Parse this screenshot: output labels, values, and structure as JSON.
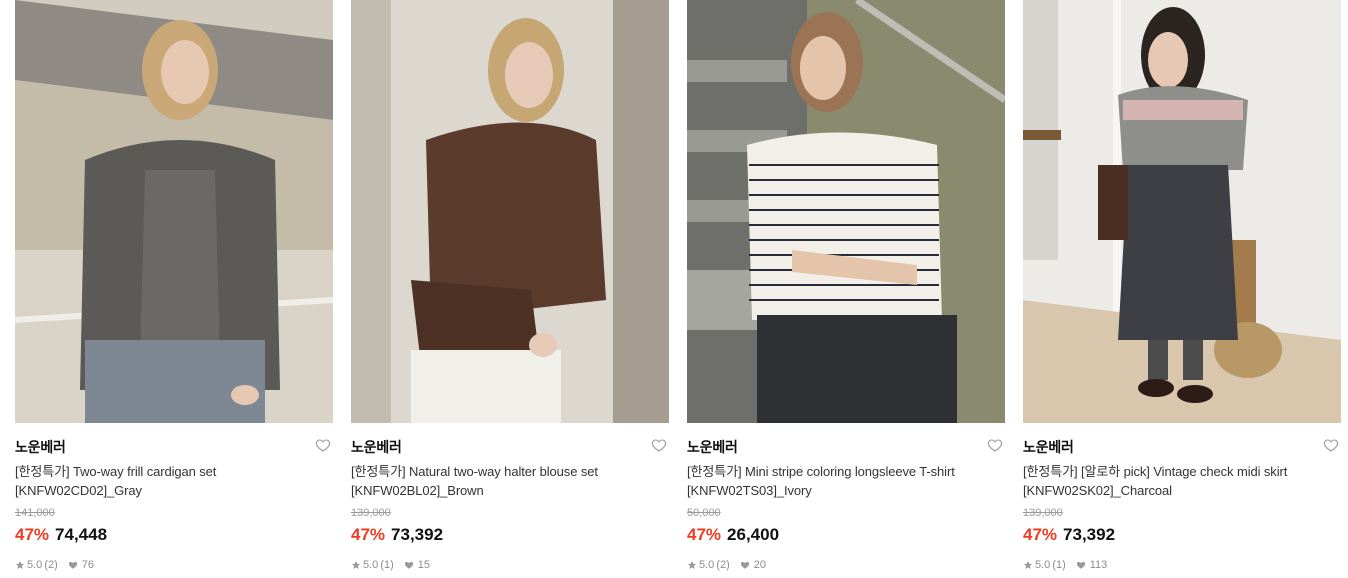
{
  "products": [
    {
      "brand": "노운베러",
      "title_line1": "[한정특가] Two-way frill cardigan set",
      "title_line2": "[KNFW02CD02]_Gray",
      "original_price": "141,000",
      "discount": "47%",
      "price": "74,448",
      "rating": "5.0",
      "review_count": "(2)",
      "likes": "76",
      "photo_palette": {
        "bg": "#cfc8bc",
        "bg2": "#8d8a84",
        "garment": "#5b5a57",
        "skin": "#e6c7b2",
        "hair": "#c9a777",
        "bottom": "#7d8894"
      }
    },
    {
      "brand": "노운베러",
      "title_line1": "[한정특가] Natural two-way halter blouse set",
      "title_line2": "[KNFW02BL02]_Brown",
      "original_price": "139,000",
      "discount": "47%",
      "price": "73,392",
      "rating": "5.0",
      "review_count": "(1)",
      "likes": "15",
      "photo_palette": {
        "bg": "#d9d5cc",
        "bg2": "#a59d8f",
        "garment": "#5a3b2c",
        "skin": "#e7c9b7",
        "hair": "#c6a673",
        "bottom": "#f1efea"
      }
    },
    {
      "brand": "노운베러",
      "title_line1": "[한정특가] Mini stripe coloring longsleeve T-shirt",
      "title_line2": "[KNFW02TS03]_Ivory",
      "original_price": "50,000",
      "discount": "47%",
      "price": "26,400",
      "rating": "5.0",
      "review_count": "(2)",
      "likes": "20",
      "photo_palette": {
        "bg": "#8a8a6e",
        "bg2": "#6e6f6a",
        "garment": "#f2efe9",
        "skin": "#e5c4ac",
        "hair": "#9b7456",
        "bottom": "#2f3034"
      }
    },
    {
      "brand": "노운베러",
      "title_line1": "[한정특가] [알로하 pick] Vintage check midi skirt",
      "title_line2": "[KNFW02SK02]_Charcoal",
      "original_price": "139,000",
      "discount": "47%",
      "price": "73,392",
      "rating": "5.0",
      "review_count": "(1)",
      "likes": "113",
      "photo_palette": {
        "bg": "#ecebe7",
        "bg2": "#d8c7ad",
        "garment": "#8e8e8a",
        "skin": "#e6c8b4",
        "hair": "#2b2421",
        "bottom": "#3d3f44"
      }
    }
  ],
  "icons": {
    "wishlist": "heart-outline-icon",
    "rating": "star-icon",
    "likes": "heart-filled-icon"
  },
  "colors": {
    "discount": "#ef3b1f",
    "price": "#111111",
    "muted": "#8c8c8c"
  }
}
